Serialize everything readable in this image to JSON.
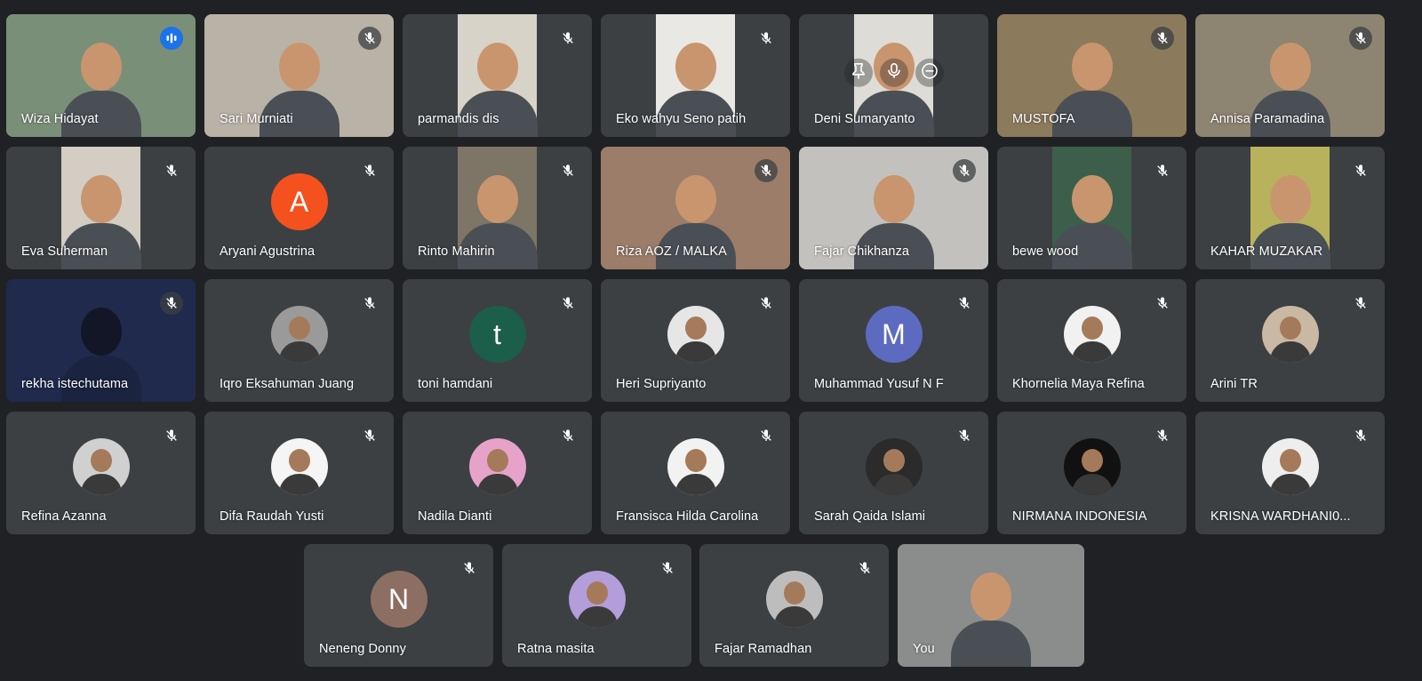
{
  "theme": {
    "background": "#202124",
    "tile_background": "#3c4043",
    "speaking_border": "#8ab4f8",
    "speaking_indicator": "#1a73e8"
  },
  "participants": [
    {
      "name": "Wiza Hidayat",
      "mic": "speaking",
      "media": "video",
      "bg": "#7a8f78"
    },
    {
      "name": "Sari Murniati",
      "mic": "muted",
      "media": "video",
      "bg": "#b9b2a6"
    },
    {
      "name": "parmandis dis",
      "mic": "muted",
      "media": "video-narrow",
      "bg": "#d8d3c8"
    },
    {
      "name": "Eko wahyu Seno patih",
      "mic": "muted",
      "media": "video-narrow",
      "bg": "#e9e8e4"
    },
    {
      "name": "Deni Sumaryanto",
      "mic": "none",
      "media": "video-narrow",
      "bg": "#dedcd6"
    },
    {
      "name": "MUSTOFA",
      "mic": "muted",
      "media": "video",
      "bg": "#8c7a5c"
    },
    {
      "name": "Annisa Paramadina",
      "mic": "muted",
      "media": "video",
      "bg": "#8d8472"
    },
    {
      "name": "Eva Suherman",
      "mic": "muted",
      "media": "video-narrow",
      "bg": "#d3cdc3"
    },
    {
      "name": "Aryani Agustrina",
      "mic": "muted",
      "media": "letter",
      "letter": "A",
      "avatar_color": "#f4511e"
    },
    {
      "name": "Rinto Mahirin",
      "mic": "muted",
      "media": "video-narrow",
      "bg": "#7d7566"
    },
    {
      "name": "Riza AOZ / MALKA",
      "mic": "muted",
      "media": "video",
      "bg": "#9b7d6a"
    },
    {
      "name": "Fajar Chikhanza",
      "mic": "muted",
      "media": "video",
      "bg": "#c2c1bd"
    },
    {
      "name": "bewe wood",
      "mic": "muted",
      "media": "video-narrow",
      "bg": "#3d5e4a"
    },
    {
      "name": "KAHAR MUZAKAR",
      "mic": "muted",
      "media": "video-narrow",
      "bg": "#b8b25c"
    },
    {
      "name": "rekha istechutama",
      "mic": "muted",
      "media": "video",
      "bg": "#1f2a4d"
    },
    {
      "name": "Iqro Eksahuman Juang",
      "mic": "muted",
      "media": "photo",
      "avatar_color": "#9a9a9a"
    },
    {
      "name": "toni hamdani",
      "mic": "muted",
      "media": "letter",
      "letter": "t",
      "avatar_color": "#1b5e4a"
    },
    {
      "name": "Heri Supriyanto",
      "mic": "muted",
      "media": "photo",
      "avatar_color": "#e6e6e6"
    },
    {
      "name": "Muhammad Yusuf N F",
      "mic": "muted",
      "media": "letter",
      "letter": "M",
      "avatar_color": "#5c6bc0"
    },
    {
      "name": "Khornelia Maya Refina",
      "mic": "muted",
      "media": "photo",
      "avatar_color": "#f1f1f1"
    },
    {
      "name": "Arini TR",
      "mic": "muted",
      "media": "photo",
      "avatar_color": "#c9b8a4"
    },
    {
      "name": "Refina Azanna",
      "mic": "muted",
      "media": "photo",
      "avatar_color": "#d0d0d0"
    },
    {
      "name": "Difa Raudah Yusti",
      "mic": "muted",
      "media": "photo",
      "avatar_color": "#f5f5f5"
    },
    {
      "name": "Nadila Dianti",
      "mic": "muted",
      "media": "photo",
      "avatar_color": "#e7a2c9"
    },
    {
      "name": "Fransisca Hilda Carolina",
      "mic": "muted",
      "media": "photo",
      "avatar_color": "#f2f2f2"
    },
    {
      "name": "Sarah Qaida Islami",
      "mic": "muted",
      "media": "photo",
      "avatar_color": "#2b2b2b"
    },
    {
      "name": "NIRMANA INDONESIA",
      "mic": "muted",
      "media": "photo",
      "avatar_color": "#111111"
    },
    {
      "name": "KRISNA WARDHANI0...",
      "mic": "muted",
      "media": "photo",
      "avatar_color": "#eeeeee"
    },
    {
      "name": "Neneng Donny",
      "mic": "muted",
      "media": "letter",
      "letter": "N",
      "avatar_color": "#8d6e63"
    },
    {
      "name": "Ratna masita",
      "mic": "muted",
      "media": "photo",
      "avatar_color": "#b39ddb"
    },
    {
      "name": "Fajar Ramadhan",
      "mic": "muted",
      "media": "photo",
      "avatar_color": "#bdbdbd"
    },
    {
      "name": "You",
      "mic": "none",
      "media": "video",
      "bg": "#8a8d8c"
    }
  ]
}
